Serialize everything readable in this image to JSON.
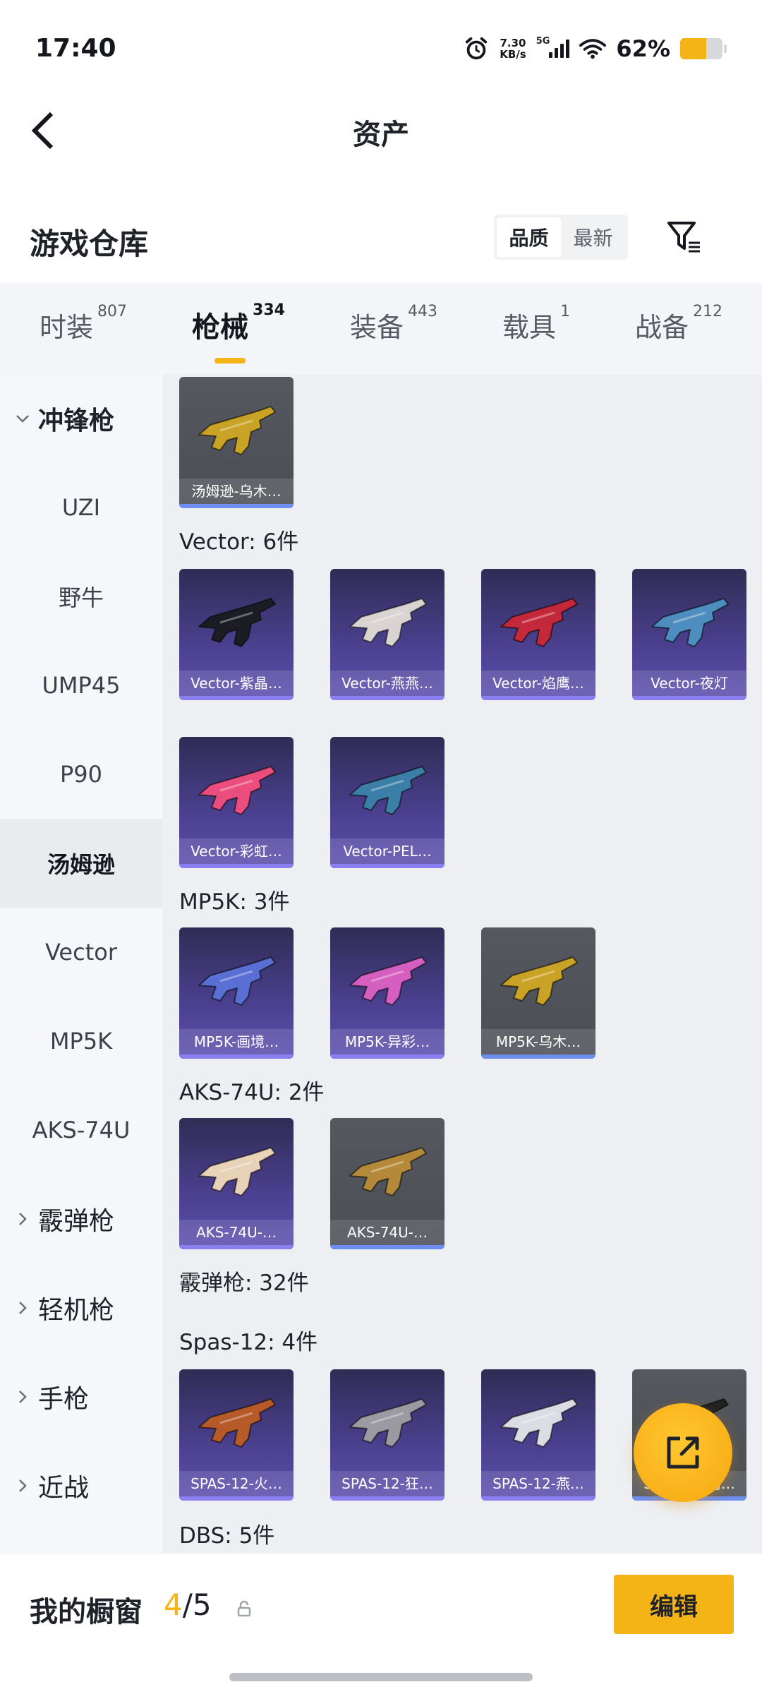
{
  "status_bar": {
    "time": "17:40",
    "net_speed_value": "7.30",
    "net_speed_unit": "KB/s",
    "network": "5G",
    "battery_percent": "62%",
    "battery_level": 0.62,
    "icons": [
      "alarm-icon",
      "signal-icon",
      "wifi-icon",
      "battery-icon"
    ]
  },
  "header": {
    "title": "资产",
    "back_icon": "back-chevron-icon"
  },
  "warehouse": {
    "title": "游戏仓库",
    "sort_options": [
      "品质",
      "最新"
    ],
    "sort_selected": "品质",
    "filter_icon": "filter-icon"
  },
  "tabs": [
    {
      "label": "时装",
      "count": "807"
    },
    {
      "label": "枪械",
      "count": "334",
      "active": true
    },
    {
      "label": "装备",
      "count": "443"
    },
    {
      "label": "载具",
      "count": "1"
    },
    {
      "label": "战备",
      "count": "212"
    }
  ],
  "sidebar": {
    "items": [
      {
        "label": "冲锋枪",
        "type": "group",
        "expanded": true
      },
      {
        "label": "UZI"
      },
      {
        "label": "野牛"
      },
      {
        "label": "UMP45"
      },
      {
        "label": "P90"
      },
      {
        "label": "汤姆逊",
        "active": true
      },
      {
        "label": "Vector"
      },
      {
        "label": "MP5K"
      },
      {
        "label": "AKS-74U"
      },
      {
        "label": "霰弹枪",
        "type": "group"
      },
      {
        "label": "轻机枪",
        "type": "group"
      },
      {
        "label": "手枪",
        "type": "group"
      },
      {
        "label": "近战",
        "type": "group"
      }
    ]
  },
  "sections": [
    {
      "title": "",
      "cards": [
        {
          "name": "汤姆逊-乌木…",
          "rarity": "grey",
          "color": "#c9a326"
        }
      ]
    },
    {
      "title": "Vector: 6件",
      "cards": [
        {
          "name": "Vector-紫晶…",
          "rarity": "epic",
          "color": "#1c1d24"
        },
        {
          "name": "Vector-燕燕…",
          "rarity": "epic",
          "color": "#d9d4d2"
        },
        {
          "name": "Vector-焰鹰…",
          "rarity": "epic",
          "color": "#c3293a"
        },
        {
          "name": "Vector-夜灯",
          "rarity": "epic",
          "color": "#4e8dbf"
        },
        {
          "name": "Vector-彩虹…",
          "rarity": "epic",
          "color": "#ea4d7e"
        },
        {
          "name": "Vector-PEL…",
          "rarity": "epic",
          "color": "#3b7fa8"
        }
      ]
    },
    {
      "title": "MP5K: 3件",
      "cards": [
        {
          "name": "MP5K-画境…",
          "rarity": "epic",
          "color": "#5a6fd4"
        },
        {
          "name": "MP5K-异彩…",
          "rarity": "epic",
          "color": "#d45fc0"
        },
        {
          "name": "MP5K-乌木…",
          "rarity": "grey",
          "color": "#c9a326"
        }
      ]
    },
    {
      "title": "AKS-74U: 2件",
      "cards": [
        {
          "name": "AKS-74U-…",
          "rarity": "epic",
          "color": "#e8d2b8"
        },
        {
          "name": "AKS-74U-…",
          "rarity": "grey",
          "color": "#b48a3a"
        }
      ]
    },
    {
      "title": "霰弹枪: 32件",
      "cards": []
    },
    {
      "title": "Spas-12: 4件",
      "cards": [
        {
          "name": "SPAS-12-火…",
          "rarity": "epic",
          "color": "#b65a2a"
        },
        {
          "name": "SPAS-12-狂…",
          "rarity": "epic",
          "color": "#9a9aa0"
        },
        {
          "name": "SPAS-12-燕…",
          "rarity": "epic",
          "color": "#dcdde4"
        },
        {
          "name": "SPAS-12-乌…",
          "rarity": "grey",
          "color": "#222222"
        }
      ]
    },
    {
      "title": "DBS: 5件",
      "cards": []
    }
  ],
  "fab": {
    "icon": "share-external-icon"
  },
  "bottom_bar": {
    "title": "我的橱窗",
    "current": "4",
    "separator": "/",
    "total": "5",
    "lock_icon": "unlock-icon",
    "edit_label": "编辑"
  }
}
